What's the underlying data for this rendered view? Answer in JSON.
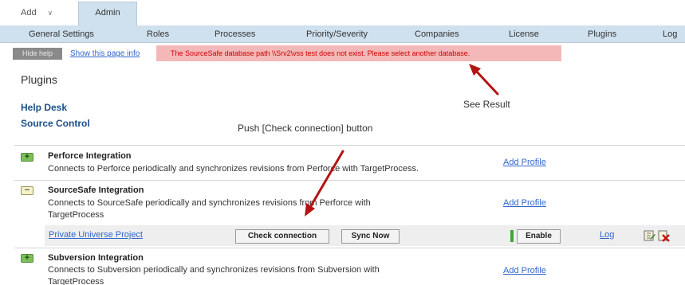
{
  "topbar": {
    "add_label": "Add",
    "add_chevron": "∨",
    "active_tab": "Admin"
  },
  "nav": {
    "items": [
      "General Settings",
      "Roles",
      "Processes",
      "Priority/Severity",
      "Companies",
      "License",
      "Plugins",
      "Log"
    ]
  },
  "infobar": {
    "hide_label": "Hide help",
    "show_info_link": "Show this page info",
    "error_message": "The SourceSafe database path \\\\Srv2\\vss test does not exist. Please select another database."
  },
  "page": {
    "title": "Plugins",
    "categories": [
      "Help Desk",
      "Source Control"
    ]
  },
  "annotations": {
    "see_result": "See Result",
    "push_button": "Push [Check connection] button"
  },
  "plugins": [
    {
      "name": "Perforce Integration",
      "desc_line1": "Connects to Perforce periodically and synchronizes revisions from Perforce with TargetProcess.",
      "desc_line2": "",
      "action": "Add Profile",
      "expander": "+"
    },
    {
      "name": "SourceSafe Integration",
      "desc_line1": "Connects to SourceSafe periodically and synchronizes revisions from Perforce with",
      "desc_line2": "TargetProcess",
      "action": "Add Profile",
      "expander": "−"
    },
    {
      "name": "Subversion Integration",
      "desc_line1": "Connects to Subversion periodically and synchronizes revisions from Subversion with",
      "desc_line2": "TargetProcess",
      "action": "Add Profile",
      "expander": "+"
    }
  ],
  "profile": {
    "name": "Private Universe Project",
    "check_connection": "Check connection",
    "sync_now": "Sync Now",
    "enable": "Enable",
    "log": "Log"
  },
  "colors": {
    "nav_bg": "#cfe0ee",
    "error_bg": "#f4b8b8",
    "error_text": "#cc0000",
    "link": "#3366cc",
    "arrow": "#b41414"
  }
}
